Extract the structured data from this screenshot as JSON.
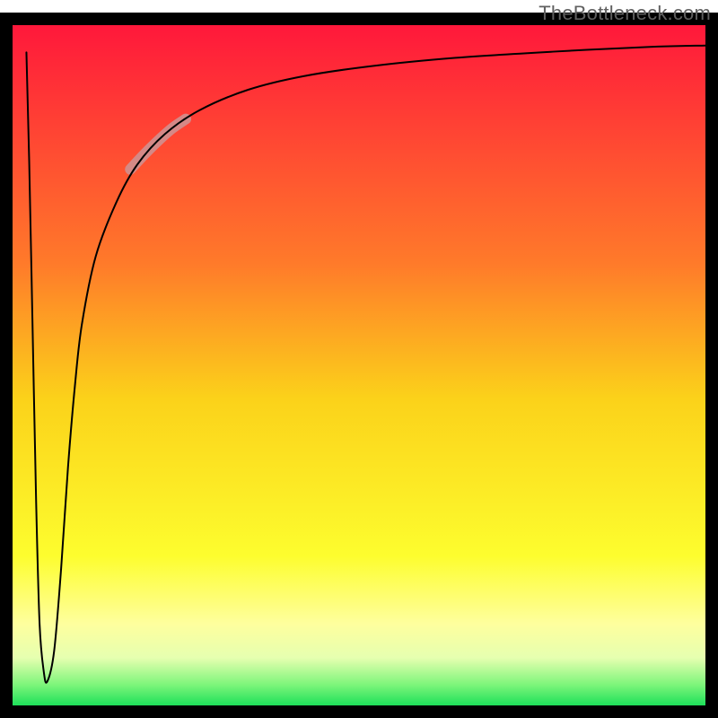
{
  "watermark": "TheBottleneck.com",
  "chart_data": {
    "type": "line",
    "title": "",
    "xlabel": "",
    "ylabel": "",
    "xlim": [
      0,
      100
    ],
    "ylim": [
      0,
      100
    ],
    "grid": false,
    "legend": {
      "visible": false
    },
    "background": {
      "type": "vertical-gradient",
      "stops": [
        {
          "offset": 0.0,
          "color": "#ff183b"
        },
        {
          "offset": 0.35,
          "color": "#ff7a2a"
        },
        {
          "offset": 0.55,
          "color": "#fbd21a"
        },
        {
          "offset": 0.78,
          "color": "#fdfd2e"
        },
        {
          "offset": 0.88,
          "color": "#feff9e"
        },
        {
          "offset": 0.93,
          "color": "#e6ffb0"
        },
        {
          "offset": 0.97,
          "color": "#7cf57a"
        },
        {
          "offset": 1.0,
          "color": "#1ee05a"
        }
      ]
    },
    "frame": {
      "stroke": "#000000",
      "width": 14
    },
    "series": [
      {
        "name": "curve",
        "stroke": "#000000",
        "width": 2,
        "x": [
          2.0,
          2.4,
          2.9,
          3.4,
          3.9,
          4.5,
          5.0,
          6.0,
          7.0,
          8.0,
          9.0,
          10.0,
          12.0,
          15.0,
          18.0,
          22.0,
          27.0,
          34.0,
          42.0,
          52.0,
          64.0,
          78.0,
          92.0,
          100.0
        ],
        "y": [
          96.0,
          80.0,
          55.0,
          30.0,
          12.0,
          5.0,
          3.5,
          8.0,
          20.0,
          35.0,
          47.0,
          56.0,
          66.0,
          74.0,
          79.5,
          84.0,
          87.5,
          90.5,
          92.5,
          94.0,
          95.2,
          96.1,
          96.8,
          97.0
        ]
      }
    ],
    "highlight": {
      "name": "fade-segment",
      "stroke": "#d09090",
      "width": 12,
      "opacity": 0.9,
      "x": [
        17.0,
        19.0,
        21.0,
        23.0,
        25.0
      ],
      "y": [
        78.8,
        81.0,
        83.0,
        84.8,
        86.2
      ]
    }
  }
}
